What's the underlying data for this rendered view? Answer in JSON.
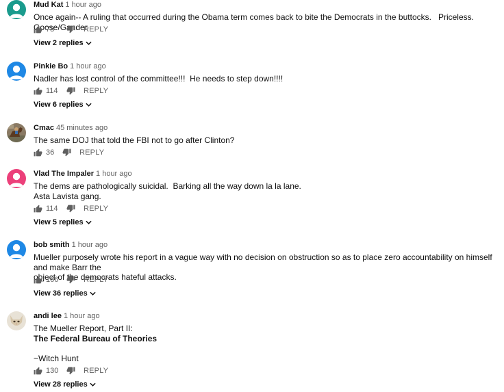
{
  "colors": {
    "avatar_teal": "#1a9b8d",
    "avatar_blue": "#1e88e5",
    "avatar_pink": "#ec407a",
    "avatar_blue2": "#1e88e5",
    "text_secondary": "#606060"
  },
  "reply_label": "REPLY",
  "comments": [
    {
      "author": "Mud Kat",
      "time": "1 hour ago",
      "lines": [
        "Once again-- A ruling that occurred during the Obama term comes back to bite the Democrats in the buttocks.   Priceless.  Goose/Gander"
      ],
      "likes": "78",
      "replies": "View 2 replies",
      "avatar": "default-teal"
    },
    {
      "author": "Pinkie Bo",
      "time": "1 hour ago",
      "lines": [
        "Nadler has lost control of the committee!!!  He needs to step down!!!!"
      ],
      "likes": "114",
      "replies": "View 6 replies",
      "avatar": "default-blue"
    },
    {
      "author": "Cmac",
      "time": "45 minutes ago",
      "lines": [
        "The same DOJ that told the FBI not to go after Clinton?"
      ],
      "likes": "36",
      "avatar": "photo-horse"
    },
    {
      "author": "Vlad The Impaler",
      "time": "1 hour ago",
      "lines": [
        "The dems are pathologically suicidal.  Barking all the way down la la lane.",
        "Asta Lavista gang."
      ],
      "likes": "114",
      "replies": "View 5 replies",
      "avatar": "default-pink"
    },
    {
      "author": "bob smith",
      "time": "1 hour ago",
      "lines": [
        "Mueller purposely wrote his report in a vague way with no decision on obstruction so as to place zero accountability on himself and make Barr the",
        "object of the democrats hateful attacks."
      ],
      "likes": "166",
      "replies": "View 36 replies",
      "avatar": "default-blue"
    },
    {
      "author": "andi lee",
      "time": "1 hour ago",
      "lines": [
        "The Mueller Report, Part II:",
        "The Federal Bureau of Theories",
        "",
        "~Witch Hunt"
      ],
      "likes": "130",
      "replies": "View 28 replies",
      "avatar": "photo-cat"
    }
  ]
}
